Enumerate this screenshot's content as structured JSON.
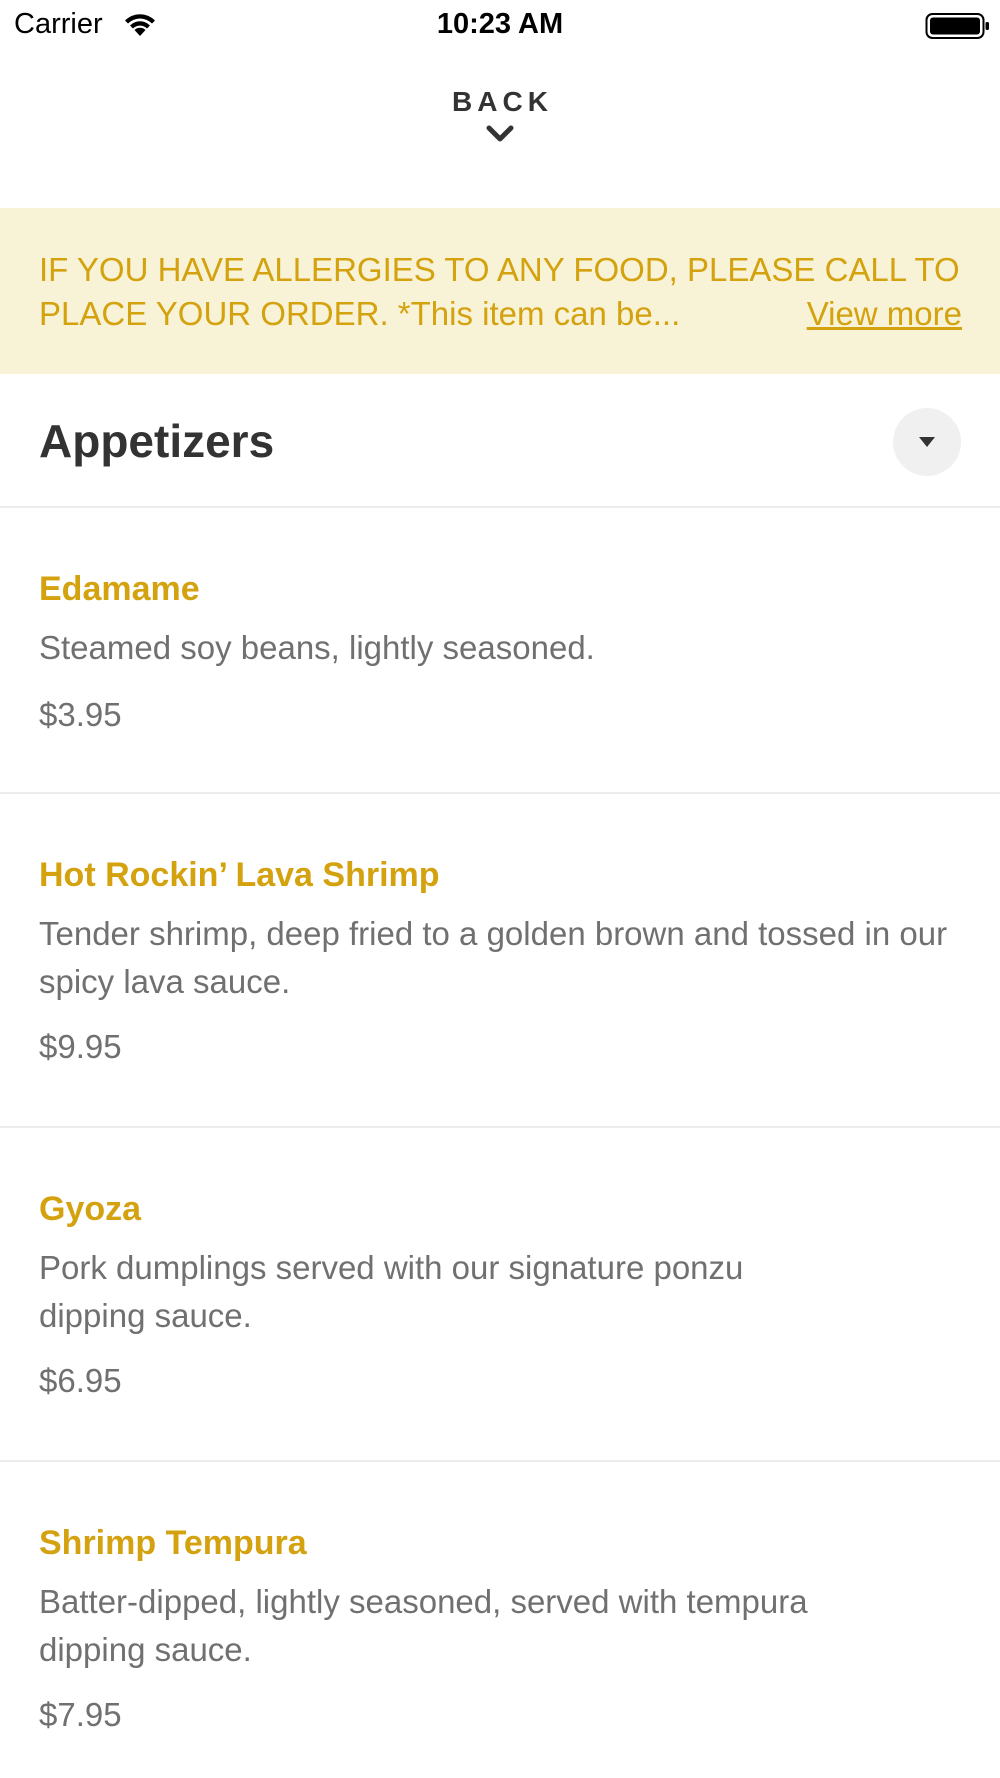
{
  "status_bar": {
    "carrier": "Carrier",
    "time": "10:23 AM"
  },
  "nav": {
    "back_label": "BACK"
  },
  "banner": {
    "text": "IF YOU HAVE ALLERGIES TO ANY FOOD, PLEASE CALL TO PLACE YOUR ORDER. *This item can be...",
    "view_more": "View more"
  },
  "category": {
    "title": "Appetizers"
  },
  "items": [
    {
      "name": "Edamame",
      "description": "Steamed soy beans, lightly seasoned.",
      "price": "$3.95"
    },
    {
      "name": "Hot Rockin’ Lava Shrimp",
      "description": "Tender shrimp, deep fried to a golden brown and tossed in our spicy lava sauce.",
      "price": "$9.95"
    },
    {
      "name": "Gyoza",
      "description": "Pork dumplings served with our signature ponzu dipping sauce.",
      "price": "$6.95"
    },
    {
      "name": "Shrimp Tempura",
      "description": "Batter-dipped, lightly seasoned, served with tempura dipping sauce.",
      "price": "$7.95"
    }
  ],
  "colors": {
    "accent": "#d4a20f",
    "banner_bg": "#f8f3d6",
    "text_dark": "#333333",
    "text_muted": "#707070"
  }
}
